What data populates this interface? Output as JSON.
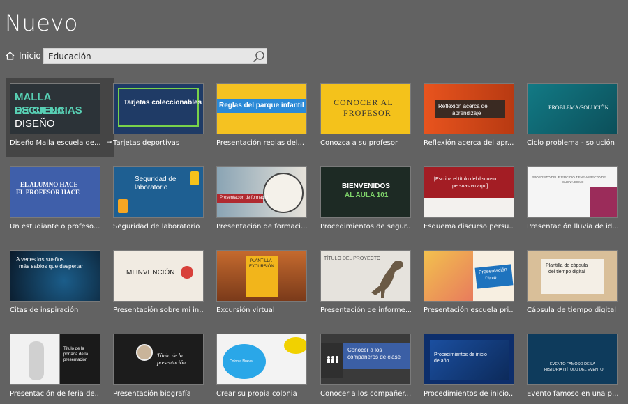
{
  "header": {
    "title": "Nuevo"
  },
  "nav": {
    "home_label": "Inicio"
  },
  "search": {
    "value": "Educación"
  },
  "templates": [
    {
      "caption": "Diseño Malla escuela de...",
      "thumb_lines": [
        "MALLA ESCUELA",
        "DE CIENCIAS",
        "DISEÑO"
      ]
    },
    {
      "caption": "Tarjetas deportivas",
      "thumb_lines": [
        "Tarjetas coleccionables"
      ]
    },
    {
      "caption": "Presentación reglas del...",
      "thumb_lines": [
        "Reglas del parque infantil"
      ]
    },
    {
      "caption": "Conozca a su profesor",
      "thumb_lines": [
        "CONOCER AL",
        "PROFESOR"
      ]
    },
    {
      "caption": "Reflexión acerca del apr...",
      "thumb_lines": [
        "Reflexión acerca del",
        "aprendizaje"
      ]
    },
    {
      "caption": "Ciclo problema - solución",
      "thumb_lines": [
        "PROBLEMA/SOLUCIÓN"
      ]
    },
    {
      "caption": "Un estudiante o profeso...",
      "thumb_lines": [
        "EL ALUMNO HACE",
        "EL PROFESOR HACE"
      ]
    },
    {
      "caption": "Seguridad de laboratorio",
      "thumb_lines": [
        "Seguridad de",
        "laboratorio"
      ]
    },
    {
      "caption": "Presentación de formaci...",
      "thumb_lines": [
        "Presentación de formación"
      ]
    },
    {
      "caption": "Procedimientos de segur...",
      "thumb_lines": [
        "BIENVENIDOS",
        "AL AULA 101"
      ]
    },
    {
      "caption": "Esquema discurso persu...",
      "thumb_lines": [
        "[Escriba el título del discurso",
        "persuasivo aquí]"
      ]
    },
    {
      "caption": "Presentación lluvia de id...",
      "thumb_lines": [
        "PROPÓSITO DEL EJERCICIO TIENE ASPECTO DE,",
        "SUENA COMO"
      ]
    },
    {
      "caption": "Citas de inspiración",
      "thumb_lines": [
        "A veces los sueños",
        "más sabios que despertar"
      ]
    },
    {
      "caption": "Presentación sobre mi in...",
      "thumb_lines": [
        "MI INVENCIÓN"
      ]
    },
    {
      "caption": "Excursión virtual",
      "thumb_lines": [
        "PLANTILLA",
        "EXCURSIÓN"
      ]
    },
    {
      "caption": "Presentación de informe...",
      "thumb_lines": [
        "TÍTULO DEL PROYECTO"
      ]
    },
    {
      "caption": "Presentación escuela pri...",
      "thumb_lines": [
        "Presentación",
        "Título"
      ]
    },
    {
      "caption": "Cápsula de tiempo digital",
      "thumb_lines": [
        "Plantilla de cápsula",
        "del tiempo digital"
      ]
    },
    {
      "caption": "Presentación de feria de...",
      "thumb_lines": [
        "Título de la",
        "portada de la",
        "presentación"
      ]
    },
    {
      "caption": "Presentación biografía",
      "thumb_lines": [
        "Título de la",
        "presentación"
      ]
    },
    {
      "caption": "Crear su propia colonia",
      "thumb_lines": [
        "Colonia Nueva"
      ]
    },
    {
      "caption": "Conocer a los compañer...",
      "thumb_lines": [
        "Conocer a los",
        "compañeros de clase"
      ]
    },
    {
      "caption": "Procedimientos de inicio...",
      "thumb_lines": [
        "Procedimientos de inicio",
        "de año"
      ]
    },
    {
      "caption": "Evento famoso en una p...",
      "thumb_lines": [
        "EVENTO FAMOSO DE LA",
        "HISTORIA (TÍTULO DEL EVENTO)"
      ]
    }
  ],
  "colors": {
    "background": "#626262",
    "selected_tile": "#454545",
    "search_bg": "#e6e6e6"
  }
}
